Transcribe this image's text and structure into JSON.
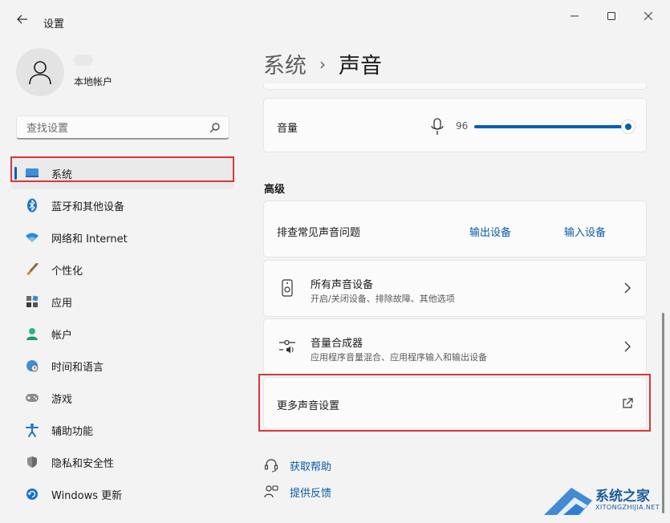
{
  "window": {
    "title": "设置"
  },
  "account": {
    "type": "本地帐户"
  },
  "search": {
    "placeholder": "查找设置"
  },
  "nav": {
    "items": [
      {
        "label": "系统",
        "icon": "display-icon",
        "active": true
      },
      {
        "label": "蓝牙和其他设备",
        "icon": "bluetooth-icon"
      },
      {
        "label": "网络和 Internet",
        "icon": "wifi-icon"
      },
      {
        "label": "个性化",
        "icon": "brush-icon"
      },
      {
        "label": "应用",
        "icon": "apps-icon"
      },
      {
        "label": "帐户",
        "icon": "person-icon"
      },
      {
        "label": "时间和语言",
        "icon": "globe-clock-icon"
      },
      {
        "label": "游戏",
        "icon": "gamepad-icon"
      },
      {
        "label": "辅助功能",
        "icon": "accessibility-icon"
      },
      {
        "label": "隐私和安全性",
        "icon": "shield-icon"
      },
      {
        "label": "Windows 更新",
        "icon": "update-icon"
      }
    ]
  },
  "breadcrumb": {
    "parent": "系统",
    "current": "声音"
  },
  "volume": {
    "label": "音量",
    "value": "96",
    "level": 0.96
  },
  "advanced": {
    "title": "高级",
    "troubleshoot": {
      "label": "排查常见声音问题",
      "output": "输出设备",
      "input": "输入设备"
    },
    "all_devices": {
      "title": "所有声音设备",
      "subtitle": "开启/关闭设备、排除故障、其他选项"
    },
    "mixer": {
      "title": "音量合成器",
      "subtitle": "应用程序音量混合、应用程序输入和输出设备"
    },
    "more": {
      "label": "更多声音设置"
    }
  },
  "help": {
    "get_help": "获取帮助",
    "feedback": "提供反馈"
  },
  "watermark": {
    "text": "系统之家",
    "url": "XITONGZHIJIA.NET"
  },
  "colors": {
    "accent": "#005fb8",
    "highlight": "#d9353a",
    "link": "#0a5aa8"
  }
}
